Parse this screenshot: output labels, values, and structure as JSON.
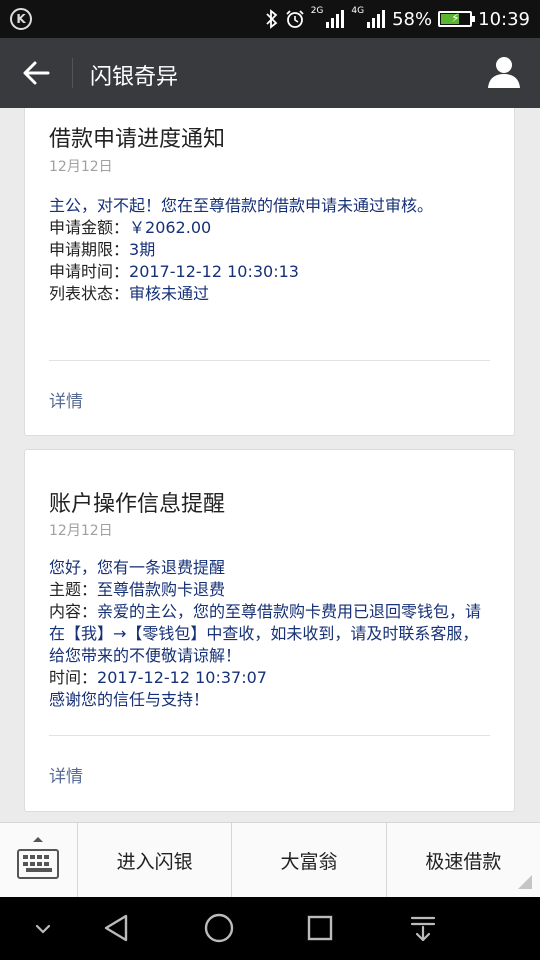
{
  "status_bar": {
    "left_icon": "k-circle-icon",
    "network_2g": "2G",
    "network_4g": "4G",
    "battery_percent": "58%",
    "battery_level": 0.58,
    "time": "10:39"
  },
  "title_bar": {
    "title": "闪银奇异"
  },
  "cards": [
    {
      "title": "借款申请进度通知",
      "date": "12月12日",
      "intro": "主公，对不起！您在至尊借款的借款申请未通过审核。",
      "rows": [
        {
          "label": "申请金额：",
          "value": "￥2062.00"
        },
        {
          "label": "申请期限：",
          "value": "3期"
        },
        {
          "label": "申请时间：",
          "value": "2017-12-12 10:30:13"
        },
        {
          "label": "列表状态：",
          "value": "审核未通过"
        }
      ],
      "detail": "详情"
    },
    {
      "title": "账户操作信息提醒",
      "date": "12月12日",
      "intro": "您好，您有一条退费提醒",
      "subject_label": "主题：",
      "subject_value": "至尊借款购卡退费",
      "content_label": "内容：",
      "content_value": "亲爱的主公，您的至尊借款购卡费用已退回零钱包，请在【我】→【零钱包】中查收，如未收到，请及时联系客服，给您带来的不便敬请谅解！",
      "time_label": "时间：",
      "time_value": "2017-12-12 10:37:07",
      "closing": "感谢您的信任与支持！",
      "detail": "详情"
    }
  ],
  "bottom_menu": {
    "items": [
      "进入闪银",
      "大富翁",
      "极速借款"
    ]
  },
  "colors": {
    "title_bar_bg": "#393a3e",
    "status_bar_bg": "#111111",
    "page_bg": "#ebebeb",
    "message_blue": "#173177",
    "link_blue": "#576b95",
    "battery_green": "#5cb531"
  }
}
